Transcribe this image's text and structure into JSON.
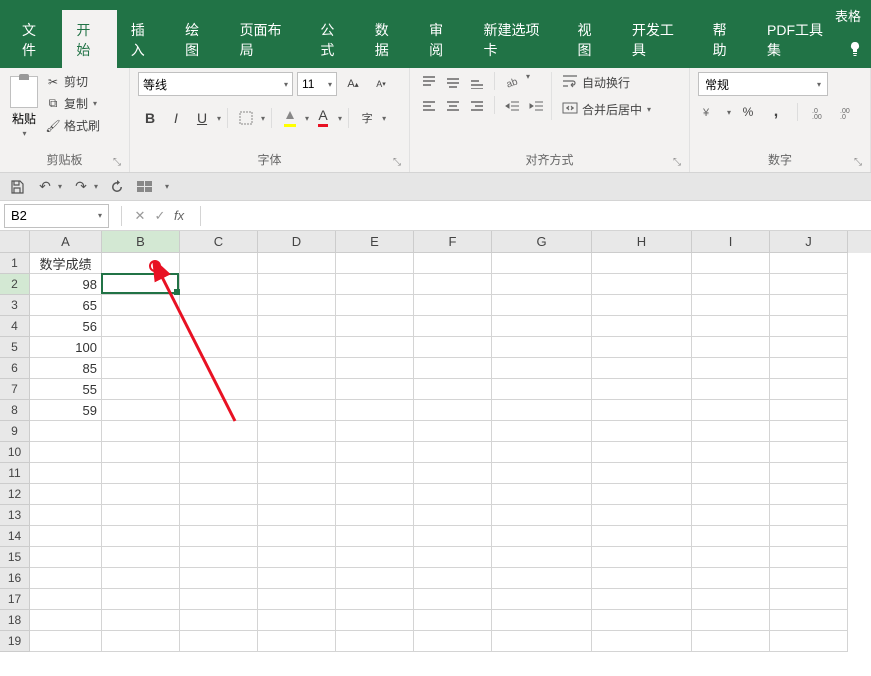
{
  "title": "表格",
  "tabs": {
    "file": "文件",
    "home": "开始",
    "insert": "插入",
    "draw": "绘图",
    "layout": "页面布局",
    "formula": "公式",
    "data": "数据",
    "review": "审阅",
    "newtab": "新建选项卡",
    "view": "视图",
    "dev": "开发工具",
    "help": "帮助",
    "pdf": "PDF工具集"
  },
  "ribbon": {
    "clipboard": {
      "paste": "粘贴",
      "cut": "剪切",
      "copy": "复制",
      "format_painter": "格式刷",
      "label": "剪贴板"
    },
    "font": {
      "name": "等线",
      "size": "11",
      "label": "字体"
    },
    "alignment": {
      "wrap": "自动换行",
      "merge": "合并后居中",
      "label": "对齐方式"
    },
    "number": {
      "format": "常规",
      "percent": "%",
      "label": "数字"
    }
  },
  "formula_bar": {
    "name_box": "B2",
    "fx": "fx",
    "value": ""
  },
  "columns": [
    "A",
    "B",
    "C",
    "D",
    "E",
    "F",
    "G",
    "H",
    "I",
    "J"
  ],
  "rows": [
    "1",
    "2",
    "3",
    "4",
    "5",
    "6",
    "7",
    "8",
    "9",
    "10",
    "11",
    "12",
    "13",
    "14",
    "15",
    "16",
    "17",
    "18",
    "19"
  ],
  "cells": {
    "A1": "数学成绩",
    "A2": "98",
    "A3": "65",
    "A4": "56",
    "A5": "100",
    "A6": "85",
    "A7": "55",
    "A8": "59"
  },
  "active_cell": "B2"
}
